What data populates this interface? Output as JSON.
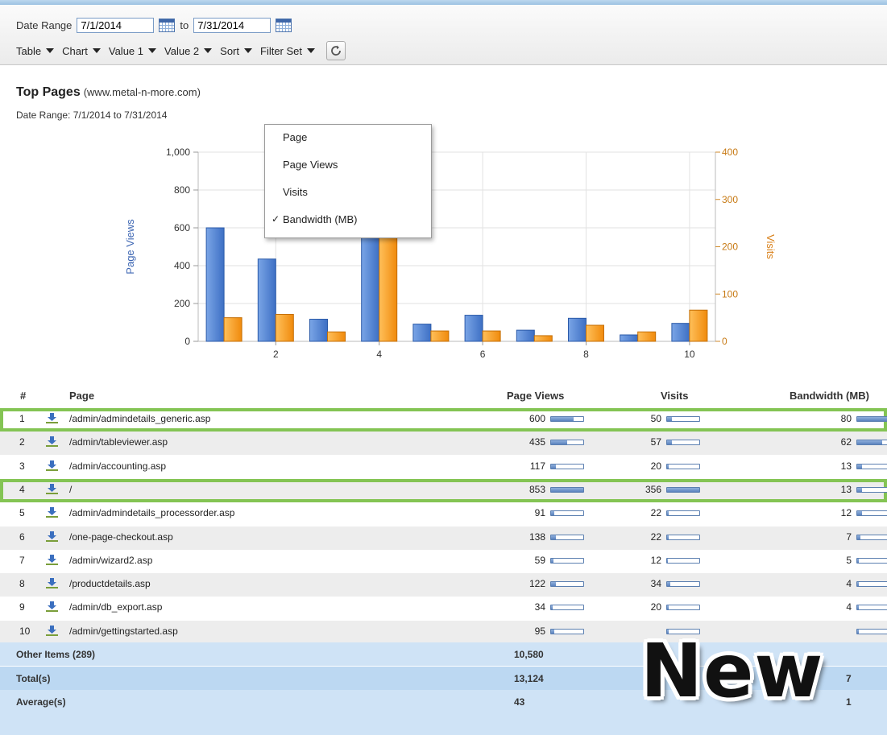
{
  "toolbar": {
    "date_range_label": "Date Range",
    "date_from": "7/1/2014",
    "to_label": "to",
    "date_to": "7/31/2014",
    "menus": [
      "Table",
      "Chart",
      "Value 1",
      "Value 2",
      "Sort",
      "Filter Set"
    ]
  },
  "report": {
    "title": "Top Pages",
    "site": "(www.metal-n-more.com)",
    "subtitle": "Date Range:  7/1/2014 to 7/31/2014"
  },
  "sort_menu": {
    "items": [
      "Page",
      "Page Views",
      "Visits",
      "Bandwidth (MB)"
    ],
    "checked": "Bandwidth (MB)"
  },
  "chart_data": {
    "type": "bar",
    "categories": [
      1,
      2,
      3,
      4,
      5,
      6,
      7,
      8,
      9,
      10
    ],
    "x_tick_labels": [
      "2",
      "4",
      "6",
      "8",
      "10"
    ],
    "ylabel": "Page Views",
    "y2label": "Visits",
    "ylim": [
      0,
      1000
    ],
    "y2lim": [
      0,
      400
    ],
    "y_ticks": [
      "0",
      "200",
      "400",
      "600",
      "800",
      "1,000"
    ],
    "y2_ticks": [
      "0",
      "100",
      "200",
      "300",
      "400"
    ],
    "series": [
      {
        "name": "Page Views",
        "axis": "left",
        "color": "#4a7fd0",
        "values": [
          600,
          435,
          117,
          853,
          91,
          138,
          59,
          122,
          34,
          95
        ]
      },
      {
        "name": "Visits",
        "axis": "right",
        "color": "#f39a1f",
        "values": [
          50,
          57,
          20,
          356,
          22,
          22,
          12,
          34,
          20,
          66
        ]
      }
    ],
    "grid": true
  },
  "table": {
    "headers": {
      "num": "#",
      "page": "Page",
      "views": "Page Views",
      "visits": "Visits",
      "bandwidth": "Bandwidth (MB)"
    },
    "rows": [
      {
        "n": "1",
        "page": "/admin/admindetails_generic.asp",
        "views": "600",
        "visits": "50",
        "bw": "80",
        "views_frac": 0.7,
        "visits_frac": 0.14,
        "bw_frac": 1.0,
        "highlight": true
      },
      {
        "n": "2",
        "page": "/admin/tableviewer.asp",
        "views": "435",
        "visits": "57",
        "bw": "62",
        "views_frac": 0.51,
        "visits_frac": 0.16,
        "bw_frac": 0.78,
        "highlight": false
      },
      {
        "n": "3",
        "page": "/admin/accounting.asp",
        "views": "117",
        "visits": "20",
        "bw": "13",
        "views_frac": 0.14,
        "visits_frac": 0.06,
        "bw_frac": 0.16,
        "highlight": false
      },
      {
        "n": "4",
        "page": "/",
        "views": "853",
        "visits": "356",
        "bw": "13",
        "views_frac": 1.0,
        "visits_frac": 1.0,
        "bw_frac": 0.16,
        "highlight": true
      },
      {
        "n": "5",
        "page": "/admin/admindetails_processorder.asp",
        "views": "91",
        "visits": "22",
        "bw": "12",
        "views_frac": 0.11,
        "visits_frac": 0.06,
        "bw_frac": 0.15,
        "highlight": false
      },
      {
        "n": "6",
        "page": "/one-page-checkout.asp",
        "views": "138",
        "visits": "22",
        "bw": "7",
        "views_frac": 0.16,
        "visits_frac": 0.06,
        "bw_frac": 0.09,
        "highlight": false
      },
      {
        "n": "7",
        "page": "/admin/wizard2.asp",
        "views": "59",
        "visits": "12",
        "bw": "5",
        "views_frac": 0.07,
        "visits_frac": 0.03,
        "bw_frac": 0.06,
        "highlight": false
      },
      {
        "n": "8",
        "page": "/productdetails.asp",
        "views": "122",
        "visits": "34",
        "bw": "4",
        "views_frac": 0.14,
        "visits_frac": 0.1,
        "bw_frac": 0.05,
        "highlight": false
      },
      {
        "n": "9",
        "page": "/admin/db_export.asp",
        "views": "34",
        "visits": "20",
        "bw": "4",
        "views_frac": 0.04,
        "visits_frac": 0.06,
        "bw_frac": 0.05,
        "highlight": false
      },
      {
        "n": "10",
        "page": "/admin/gettingstarted.asp",
        "views": "95",
        "visits": "",
        "bw": "",
        "views_frac": 0.11,
        "visits_frac": 0.05,
        "bw_frac": 0.05,
        "highlight": false
      }
    ],
    "summary": [
      {
        "label": "Other Items (289)",
        "views": "10,580",
        "bw": ""
      },
      {
        "label": "Total(s)",
        "views": "13,124",
        "bw": "7"
      },
      {
        "label": "Average(s)",
        "views": "43",
        "bw": "1"
      }
    ]
  },
  "badge": "New",
  "colors": {
    "page_views": "#4a7fd0",
    "visits": "#f39a1f",
    "highlight": "#84c454",
    "summary_bg": "#cfe3f6"
  }
}
